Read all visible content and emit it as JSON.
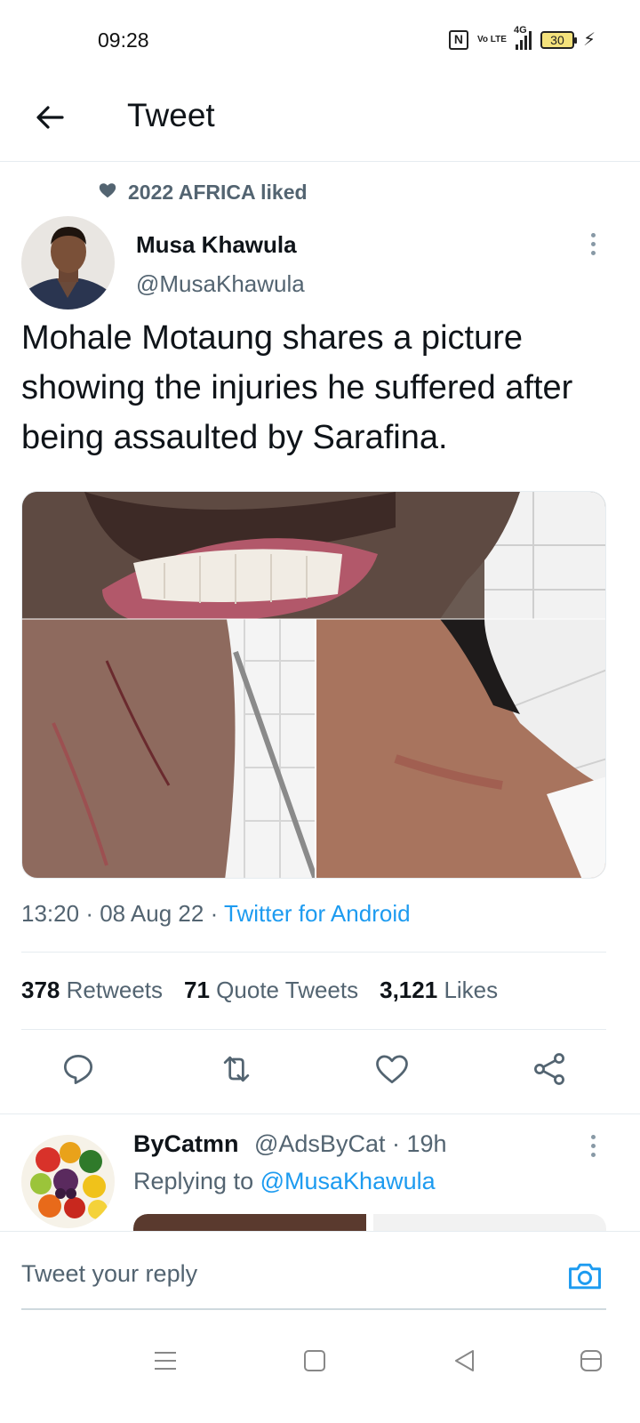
{
  "status_bar": {
    "time": "09:28",
    "volte": "Vo LTE",
    "network": "4G",
    "battery": "30",
    "icons": [
      "nfc-icon",
      "volte-icon",
      "signal-icon",
      "battery-icon",
      "charging-icon"
    ]
  },
  "header": {
    "title": "Tweet",
    "back_icon": "arrow-left-icon"
  },
  "social_context": {
    "text": "2022 AFRICA liked",
    "icon": "heart-filled-icon"
  },
  "tweet": {
    "author_name": "Musa Khawula",
    "author_handle": "@MusaKhawula",
    "text": "Mohale Motaung shares a picture showing the injuries he suffered after being assaulted by Sarafina.",
    "time": "13:20",
    "date": "08 Aug 22",
    "source": "Twitter for Android",
    "separator": "·",
    "stats": {
      "retweets_count": "378",
      "retweets_label": "Retweets",
      "quotes_count": "71",
      "quotes_label": "Quote Tweets",
      "likes_count": "3,121",
      "likes_label": "Likes"
    },
    "actions": [
      "reply-icon",
      "retweet-icon",
      "like-icon",
      "share-icon"
    ]
  },
  "reply": {
    "author_name": "ByCatmn",
    "author_handle": "@AdsByCat",
    "time": "19h",
    "replying_prefix": "Replying to",
    "replying_to": "@MusaKhawula"
  },
  "composer": {
    "placeholder": "Tweet your reply",
    "icon": "camera-icon"
  },
  "nav_bar": [
    "menu-icon",
    "home-square-icon",
    "back-triangle-icon",
    "assistant-icon"
  ],
  "colors": {
    "accent": "#1d9bf0",
    "text_primary": "#0f1419",
    "text_secondary": "#536471",
    "divider": "#e6ecf0"
  }
}
